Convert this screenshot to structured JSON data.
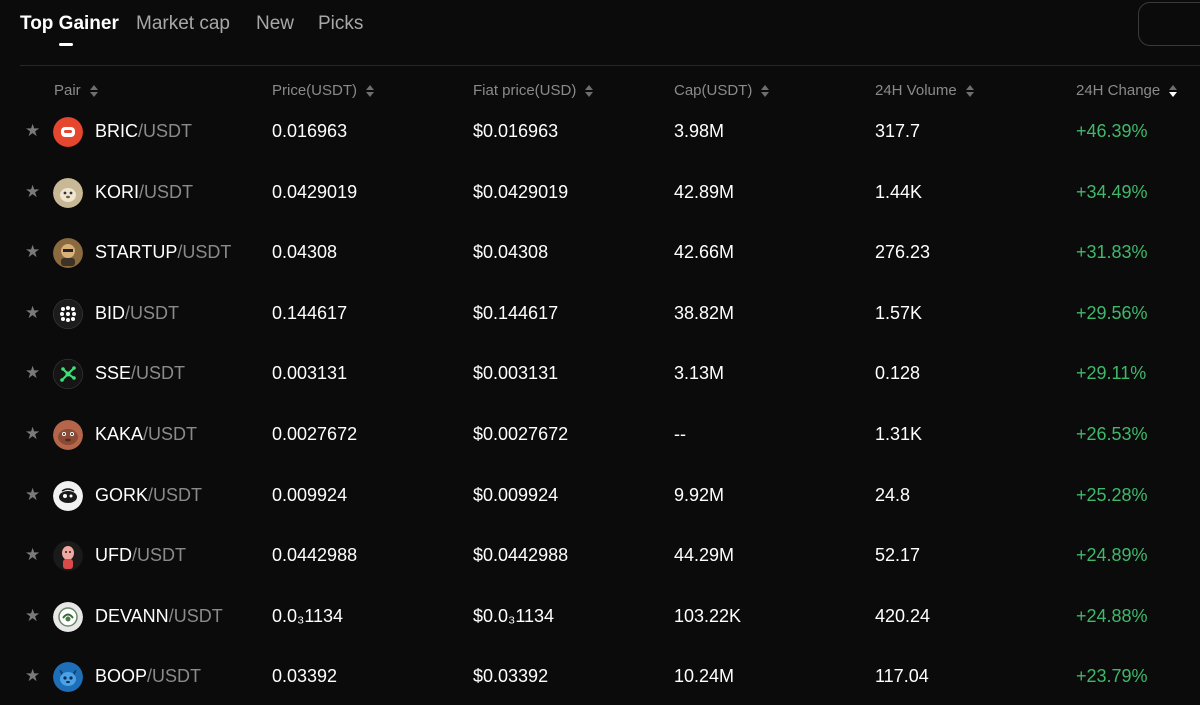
{
  "tabs": [
    {
      "label": "Top Gainer",
      "active": true
    },
    {
      "label": "Market cap",
      "active": false
    },
    {
      "label": "New",
      "active": false
    },
    {
      "label": "Picks",
      "active": false
    }
  ],
  "columns": {
    "pair": "Pair",
    "price": "Price(USDT)",
    "fiat": "Fiat price(USD)",
    "cap": "Cap(USDT)",
    "volume": "24H Volume",
    "change": "24H Change"
  },
  "rows": [
    {
      "base": "BRIC",
      "quote": "/USDT",
      "price": "0.016963",
      "fiat": "$0.016963",
      "cap": "3.98M",
      "volume": "317.7",
      "change": "+46.39%",
      "icon": "bric-coin-icon"
    },
    {
      "base": "KORI",
      "quote": "/USDT",
      "price": "0.0429019",
      "fiat": "$0.0429019",
      "cap": "42.89M",
      "volume": "1.44K",
      "change": "+34.49%",
      "icon": "kori-coin-icon"
    },
    {
      "base": "STARTUP",
      "quote": "/USDT",
      "price": "0.04308",
      "fiat": "$0.04308",
      "cap": "42.66M",
      "volume": "276.23",
      "change": "+31.83%",
      "icon": "startup-coin-icon"
    },
    {
      "base": "BID",
      "quote": "/USDT",
      "price": "0.144617",
      "fiat": "$0.144617",
      "cap": "38.82M",
      "volume": "1.57K",
      "change": "+29.56%",
      "icon": "bid-coin-icon"
    },
    {
      "base": "SSE",
      "quote": "/USDT",
      "price": "0.003131",
      "fiat": "$0.003131",
      "cap": "3.13M",
      "volume": "0.128",
      "change": "+29.11%",
      "icon": "sse-coin-icon"
    },
    {
      "base": "KAKA",
      "quote": "/USDT",
      "price": "0.0027672",
      "fiat": "$0.0027672",
      "cap": "--",
      "volume": "1.31K",
      "change": "+26.53%",
      "icon": "kaka-coin-icon"
    },
    {
      "base": "GORK",
      "quote": "/USDT",
      "price": "0.009924",
      "fiat": "$0.009924",
      "cap": "9.92M",
      "volume": "24.8",
      "change": "+25.28%",
      "icon": "gork-coin-icon"
    },
    {
      "base": "UFD",
      "quote": "/USDT",
      "price": "0.0442988",
      "fiat": "$0.0442988",
      "cap": "44.29M",
      "volume": "52.17",
      "change": "+24.89%",
      "icon": "ufd-coin-icon"
    },
    {
      "base": "DEVANN",
      "quote": "/USDT",
      "price": "0.0₃1134",
      "fiat": "$0.0₃1134",
      "cap": "103.22K",
      "volume": "420.24",
      "change": "+24.88%",
      "icon": "devann-coin-icon"
    },
    {
      "base": "BOOP",
      "quote": "/USDT",
      "price": "0.03392",
      "fiat": "$0.03392",
      "cap": "10.24M",
      "volume": "117.04",
      "change": "+23.79%",
      "icon": "boop-coin-icon"
    }
  ],
  "colors": {
    "background": "#0b0b0b",
    "positive": "#3fb86b",
    "muted": "#8a8a8a"
  },
  "icons": {
    "star": "star-icon",
    "sort": "sort-arrows-icon",
    "search": "search-box"
  }
}
